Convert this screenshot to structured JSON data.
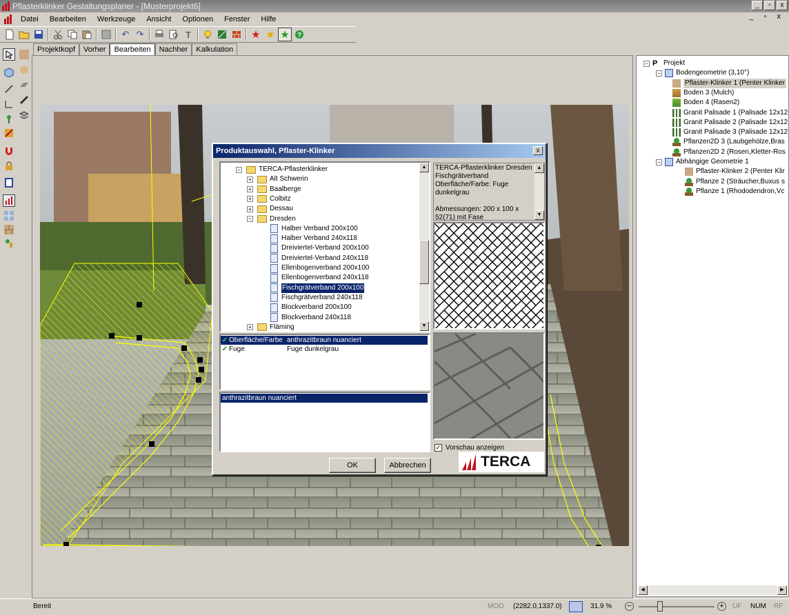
{
  "window": {
    "title": "Pflasterklinker Gestaltungsplaner - [Musterprojekt6]",
    "min": "_",
    "max": "▫",
    "close": "x"
  },
  "menu": {
    "items": [
      "Datei",
      "Bearbeiten",
      "Werkzeuge",
      "Ansicht",
      "Optionen",
      "Fenster",
      "Hilfe"
    ],
    "mdi_controls": "_ ▫ x"
  },
  "tabs": [
    "Projektkopf",
    "Vorher",
    "Bearbeiten",
    "Nachher",
    "Kalkulation"
  ],
  "active_tab": "Bearbeiten",
  "icons": {
    "toolbar": [
      "new-file-icon",
      "open-folder-icon",
      "save-icon",
      "cut-icon",
      "copy-icon",
      "paste-icon",
      "grid-icon",
      "undo-icon",
      "redo-icon",
      "print-icon",
      "print-preview-icon",
      "text-icon",
      "light-bulb-icon",
      "image-icon",
      "brick-icon",
      "star-red-icon",
      "star-yellow-icon",
      "star-green-icon",
      "help-icon"
    ]
  },
  "colors": {
    "selection": "#0a246a",
    "outline": "#ffff00",
    "terca": "#c0161e"
  },
  "dialog": {
    "title": "Produktauswahl, Pflaster-Klinker",
    "close": "x",
    "tree": {
      "root": "TERCA-Pflasterklinker",
      "folders": [
        "Alt Schwerin",
        "Baalberge",
        "Colbitz",
        "Dessau",
        "Dresden"
      ],
      "items": [
        "Halber Verband 200x100",
        "Halber Verband 240x118",
        "Dreiviertel-Verband 200x100",
        "Dreiviertel-Verband 240x118",
        "Ellenbogenverband 200x100",
        "Ellenbogenverband 240x118",
        "Fischgrätverband 200x100",
        "Fischgrätverband 240x118",
        "Blockverband 200x100",
        "Blockverband 240x118"
      ],
      "selected": "Fischgrätverband 200x100",
      "last_folder": "Fläming"
    },
    "description": "TERCA-Pflasterklinker Dresden Fischgrätverband Oberfläche/Farbe: Fuge dunkelgrau\n\nAbmessungen: 200 x 100 x 52(71) mit Fase",
    "properties": [
      {
        "name": "Oberfläche/Farbe",
        "value": "anthrazitbraun nuanciert"
      },
      {
        "name": "Fuge",
        "value": "Fuge dunkelgrau"
      }
    ],
    "option_selected": "anthrazitbraun nuanciert",
    "preview_label": "Vorschau anzeigen",
    "preview_checked": true,
    "ok": "OK",
    "cancel": "Abbrechen",
    "brand": "TERCA"
  },
  "project_tree": [
    {
      "label": "Projekt",
      "level": 0,
      "bold": true,
      "prefix": "P"
    },
    {
      "label": "Bodengeometrie (3,10°)",
      "level": 1
    },
    {
      "label": "Pflaster-Klinker 1 (Penter Klinker",
      "level": 2,
      "selected": true
    },
    {
      "label": "Boden 3 (Mulch)",
      "level": 2
    },
    {
      "label": "Boden 4 (Rasen2)",
      "level": 2
    },
    {
      "label": "Granit Palisade 1 (Palisade 12x12",
      "level": 2
    },
    {
      "label": "Granit Palisade 2 (Palisade 12x12",
      "level": 2
    },
    {
      "label": "Granit Palisade 3 (Palisade 12x12",
      "level": 2
    },
    {
      "label": "Pflanzen2D 3 (Laubgehölze,Bras",
      "level": 2
    },
    {
      "label": "Pflanzen2D 2 (Rosen,Kletter-Ros",
      "level": 2
    },
    {
      "label": "Abhängige Geometrie 1",
      "level": 1
    },
    {
      "label": "Pflaster-Klinker 2 (Penter Klir",
      "level": 3
    },
    {
      "label": "Pflanze 2 (Sträucher,Buxus s",
      "level": 3
    },
    {
      "label": "Pflanze 1 (Rhododendron,Vc",
      "level": 3
    }
  ],
  "status": {
    "left": "Bereit",
    "mod": "MOD",
    "coords": "(2282.0,1337.0)",
    "zoom": "31.9 %",
    "uf": "UF",
    "num": "NUM",
    "rf": "RF"
  }
}
